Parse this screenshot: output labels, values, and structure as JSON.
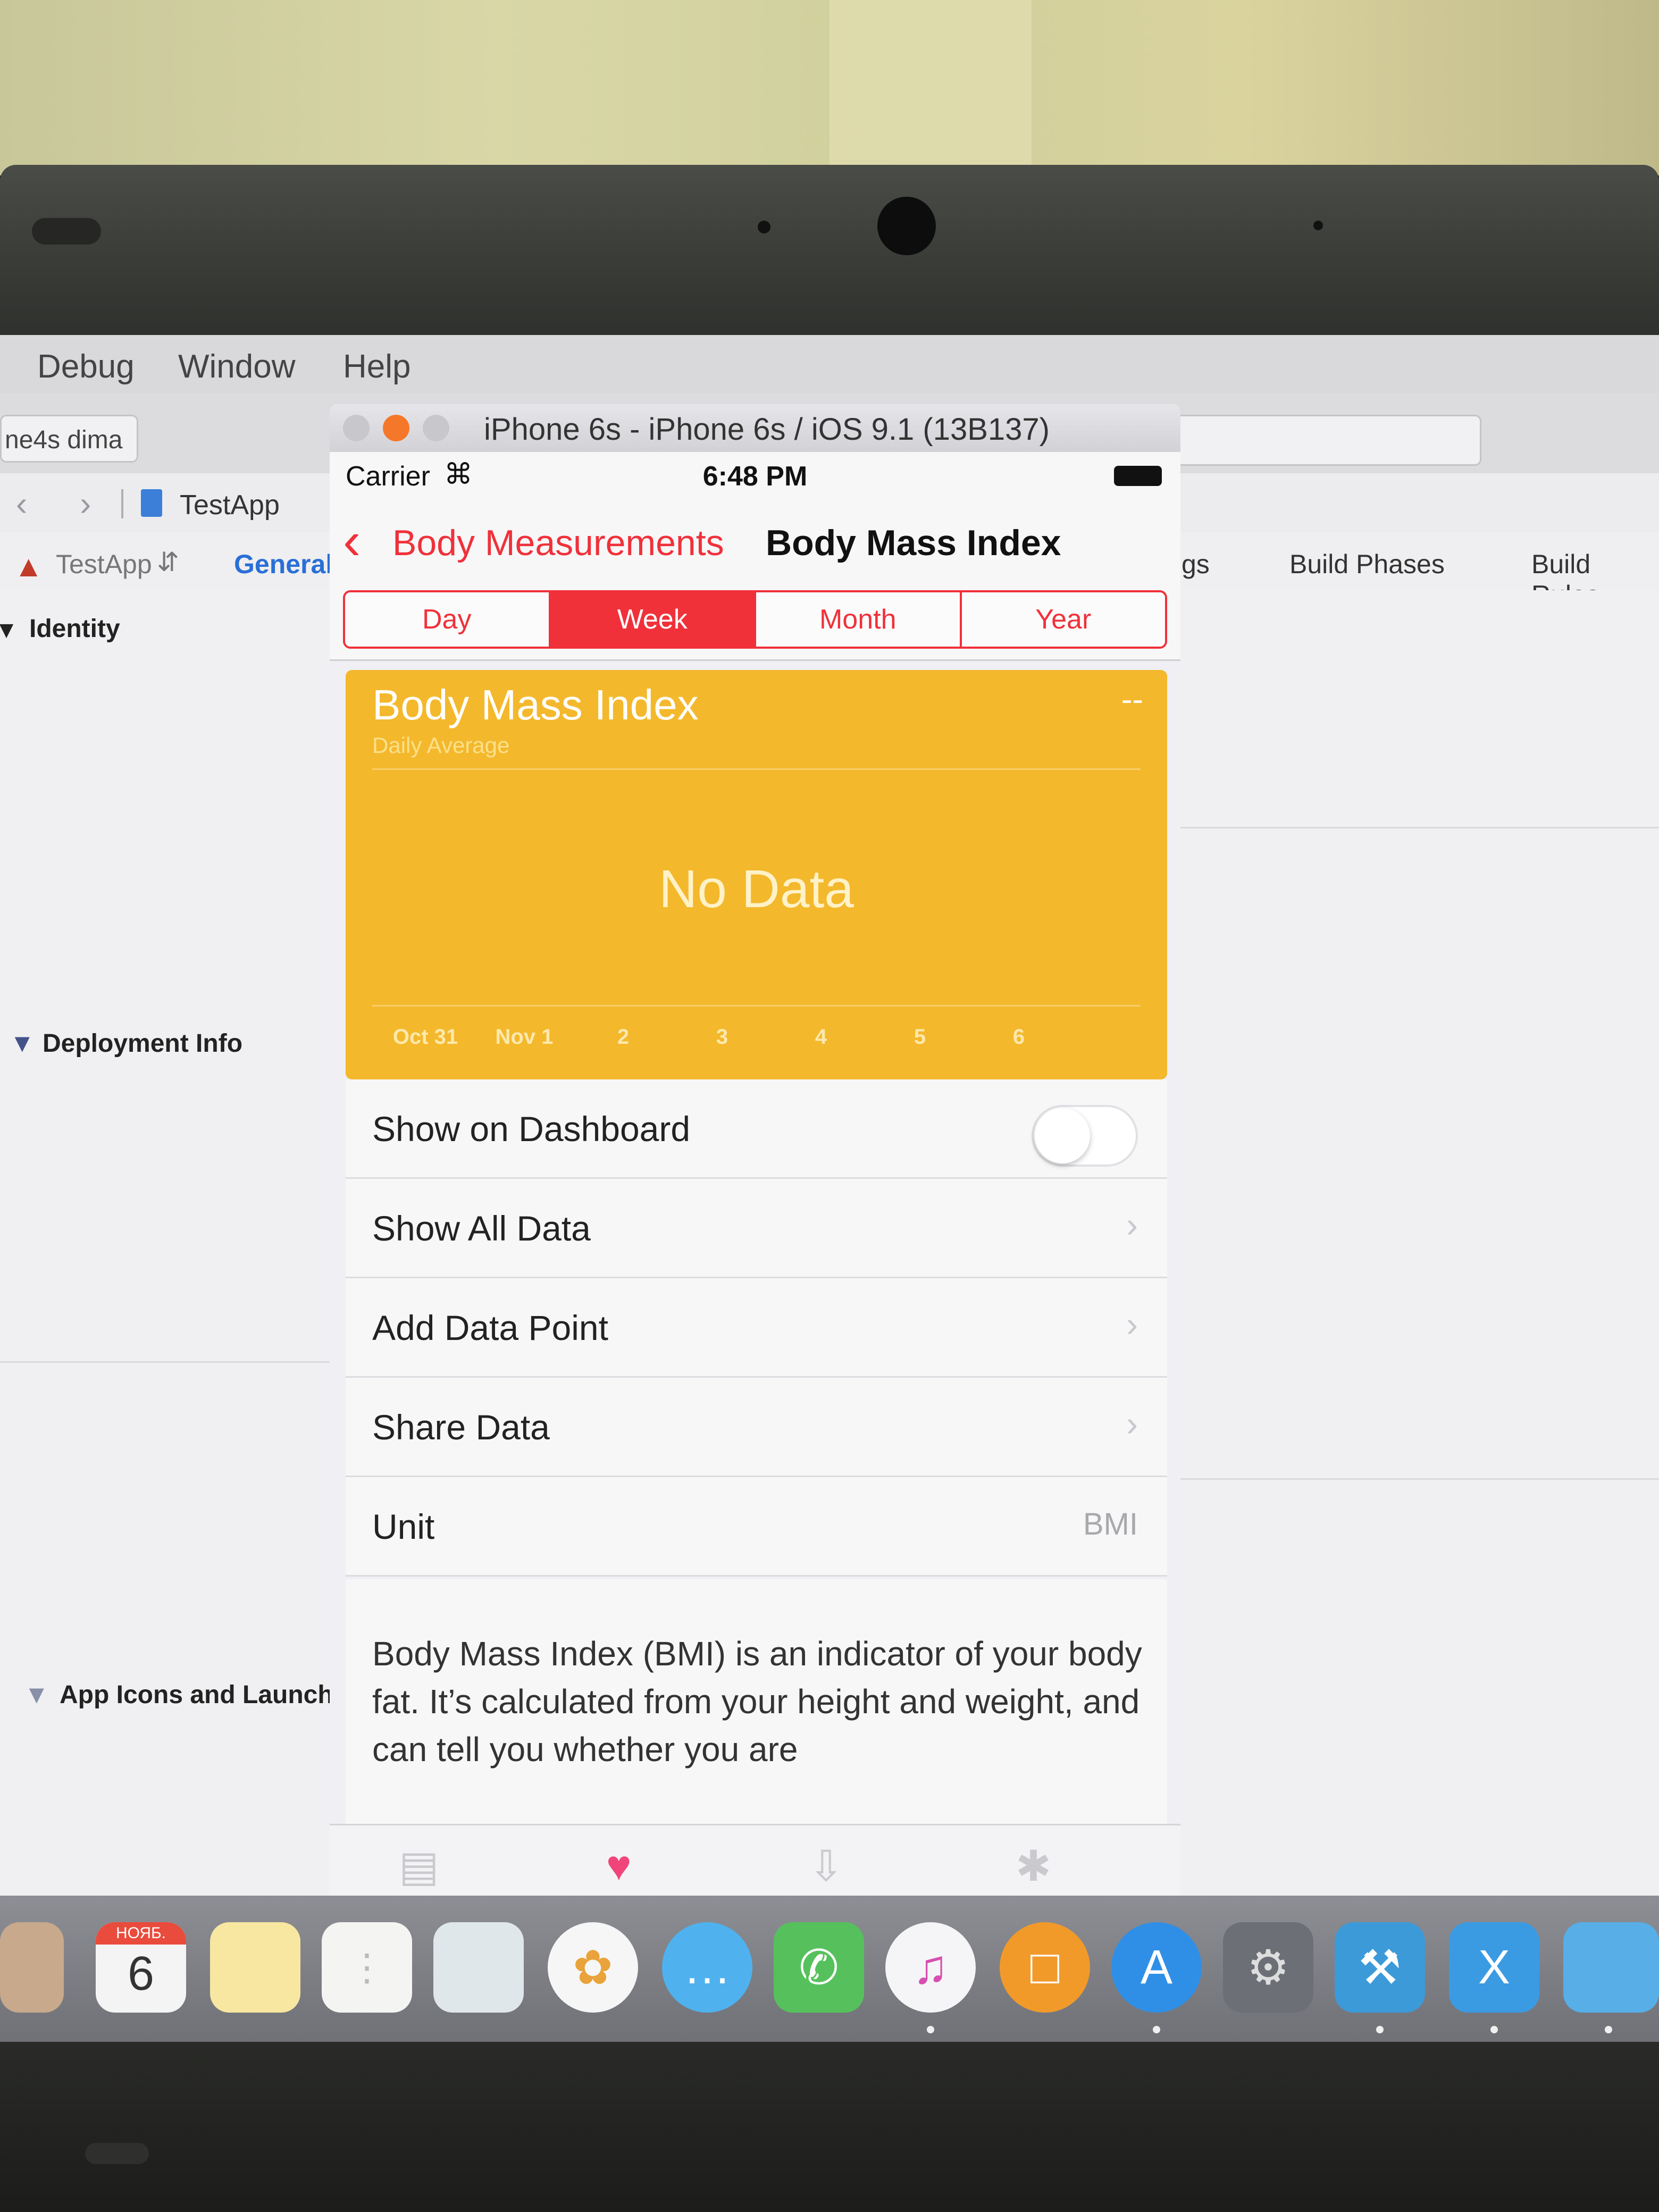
{
  "menubar": {
    "items": [
      "Debug",
      "Window",
      "Help"
    ]
  },
  "toolbar": {
    "scheme": "ne4s dima"
  },
  "jumpbar": {
    "file": "TestApp"
  },
  "target_tabs": {
    "target": "TestApp",
    "general": "General",
    "partial_tab": "gs",
    "build_phases": "Build Phases",
    "build_rules": "Build Rules"
  },
  "sections": {
    "identity": "Identity",
    "deployment": "Deployment Info",
    "app_icons": "App Icons and Launch I"
  },
  "simulator": {
    "title": "iPhone 6s - iPhone 6s / iOS 9.1 (13B137)"
  },
  "status_bar": {
    "carrier": "Carrier",
    "time": "6:48 PM"
  },
  "navigation": {
    "back_label": "Body Measurements",
    "title": "Body Mass Index"
  },
  "segments": {
    "items": [
      "Day",
      "Week",
      "Month",
      "Year"
    ],
    "selected": "Week"
  },
  "chart_card": {
    "title": "Body Mass Index",
    "subtitle": "Daily Average",
    "current_value": "--",
    "no_data": "No Data",
    "color": "#f4b82c"
  },
  "chart_data": {
    "type": "line",
    "title": "Body Mass Index",
    "subtitle": "Daily Average",
    "categories": [
      "Oct 31",
      "Nov 1",
      "2",
      "3",
      "4",
      "5",
      "6"
    ],
    "series": [],
    "annotation": "No Data"
  },
  "rows": {
    "show_on_dashboard": "Show on Dashboard",
    "show_all_data": "Show All Data",
    "add_data_point": "Add Data Point",
    "share_data": "Share Data",
    "unit_label": "Unit",
    "unit_value": "BMI"
  },
  "toggle_on": false,
  "description": "Body Mass Index (BMI) is an indicator of your body fat. It’s calculated from your height and weight, and can tell you whether you are",
  "tabbar_icons": [
    "dashboard-icon",
    "health-data-icon",
    "sources-icon",
    "medical-id-icon"
  ],
  "dock": {
    "calendar_month": "НОЯБ.",
    "calendar_day": "6",
    "icons": [
      "finder-icon",
      "calendar-icon",
      "notes-icon",
      "reminders-icon",
      "preview-icon",
      "photos-icon",
      "messages-icon",
      "facetime-icon",
      "itunes-icon",
      "ibooks-icon",
      "app-store-icon",
      "system-preferences-icon",
      "xcode-icon",
      "xamarin-icon",
      "folder-icon"
    ]
  },
  "colors": {
    "accent": "#f0313a",
    "chart": "#f4b82c"
  }
}
